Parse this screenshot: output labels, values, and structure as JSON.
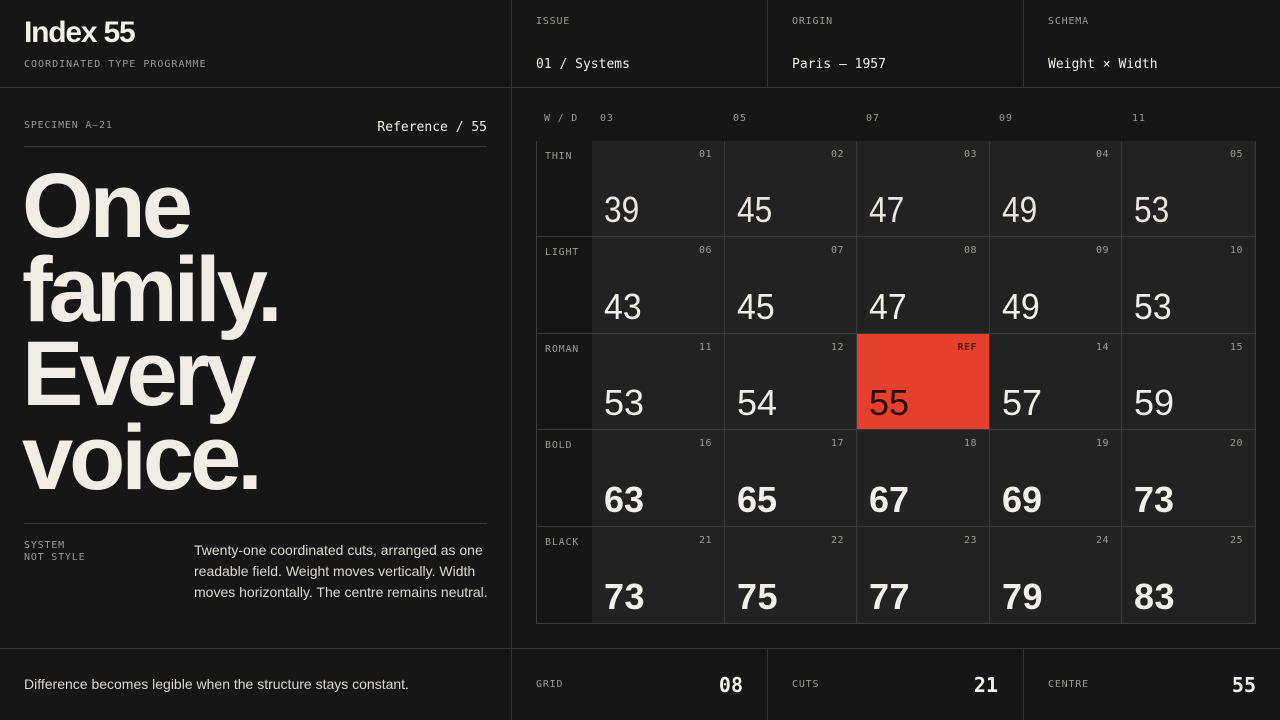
{
  "header": {
    "title": "Index 55",
    "subtitle": "COORDINATED TYPE PROGRAMME",
    "meta": [
      {
        "label": "ISSUE",
        "value": "01 / Systems"
      },
      {
        "label": "ORIGIN",
        "value": "Paris — 1957"
      },
      {
        "label": "SCHEMA",
        "value": "Weight × Width"
      }
    ]
  },
  "specimen": {
    "label": "SPECIMEN A—21",
    "reference": "Reference / 55",
    "headline": [
      "One",
      "family.",
      "Every",
      "voice."
    ],
    "tag": [
      "SYSTEM",
      "NOT STYLE"
    ],
    "body": "Twenty-one coordinated cuts, arranged as one readable field. Weight moves vertically. Width moves horizontally. The centre remains neutral."
  },
  "grid": {
    "corner_label": "W / D",
    "columns": [
      "03",
      "05",
      "07",
      "09",
      "11"
    ],
    "rows": [
      {
        "label": "THIN",
        "cells": [
          {
            "idx": "01",
            "val": "39"
          },
          {
            "idx": "02",
            "val": "45"
          },
          {
            "idx": "03",
            "val": "47"
          },
          {
            "idx": "04",
            "val": "49"
          },
          {
            "idx": "05",
            "val": "53"
          }
        ]
      },
      {
        "label": "LIGHT",
        "cells": [
          {
            "idx": "06",
            "val": "43"
          },
          {
            "idx": "07",
            "val": "45"
          },
          {
            "idx": "08",
            "val": "47"
          },
          {
            "idx": "09",
            "val": "49"
          },
          {
            "idx": "10",
            "val": "53"
          }
        ]
      },
      {
        "label": "ROMAN",
        "cells": [
          {
            "idx": "11",
            "val": "53"
          },
          {
            "idx": "12",
            "val": "54"
          },
          {
            "idx": "REF",
            "val": "55"
          },
          {
            "idx": "14",
            "val": "57"
          },
          {
            "idx": "15",
            "val": "59"
          }
        ]
      },
      {
        "label": "BOLD",
        "cells": [
          {
            "idx": "16",
            "val": "63"
          },
          {
            "idx": "17",
            "val": "65"
          },
          {
            "idx": "18",
            "val": "67"
          },
          {
            "idx": "19",
            "val": "69"
          },
          {
            "idx": "20",
            "val": "73"
          }
        ]
      },
      {
        "label": "BLACK",
        "cells": [
          {
            "idx": "21",
            "val": "73"
          },
          {
            "idx": "22",
            "val": "75"
          },
          {
            "idx": "23",
            "val": "77"
          },
          {
            "idx": "24",
            "val": "79"
          },
          {
            "idx": "25",
            "val": "83"
          }
        ]
      }
    ],
    "reference_color": "#e4402c"
  },
  "footer": {
    "note": "Difference becomes legible when the structure stays constant.",
    "stats": [
      {
        "label": "GRID",
        "value": "08"
      },
      {
        "label": "CUTS",
        "value": "21"
      },
      {
        "label": "CENTRE",
        "value": "55"
      }
    ]
  }
}
